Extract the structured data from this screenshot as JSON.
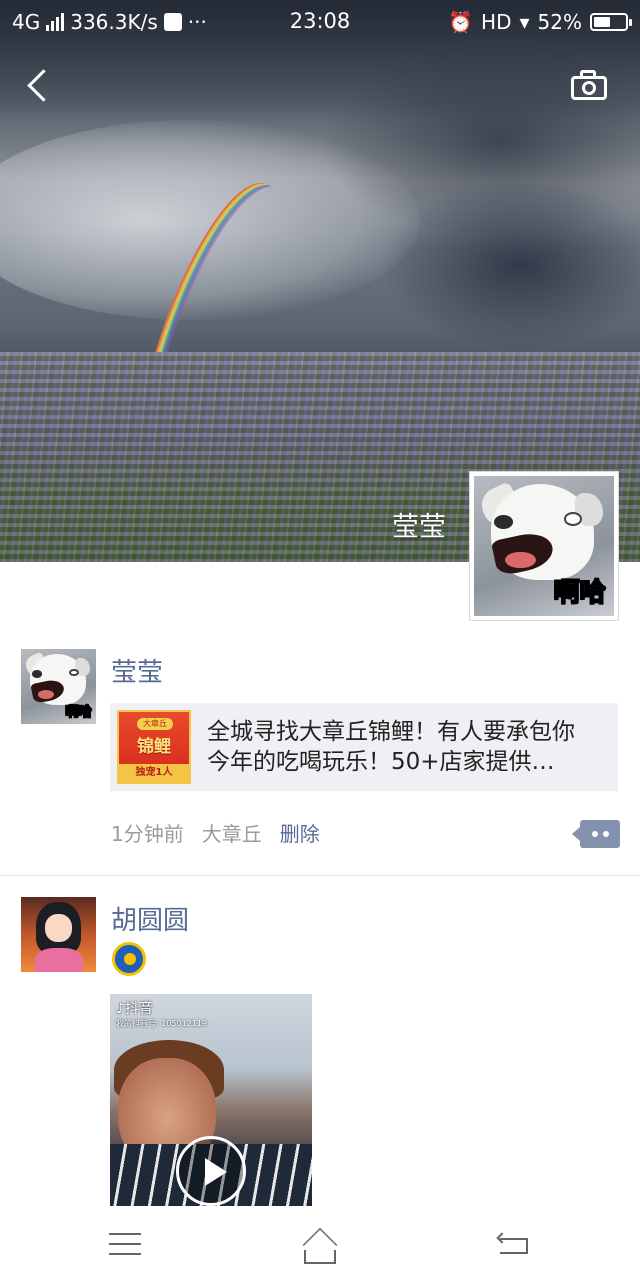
{
  "status_bar": {
    "network": "4G",
    "speed": "336.3K/s",
    "more": "···",
    "time": "23:08",
    "hd": "HD",
    "battery": "52%",
    "battery_level": 0.52
  },
  "header": {
    "back_icon": "back-chevron-icon",
    "camera_icon": "camera-icon"
  },
  "profile": {
    "name": "莹莹",
    "avatar_caption": "啊哈"
  },
  "posts": [
    {
      "username": "莹莹",
      "avatar_caption": "啊哈",
      "link": {
        "thumb_badge": "大章丘",
        "thumb_title": "锦鲤",
        "thumb_footer": "独宠1人",
        "text": "全城寻找大章丘锦鲤！有人要承包你今年的吃喝玩乐！50+店家提供…"
      },
      "time": "1分钟前",
      "location": "大章丘",
      "delete_label": "删除"
    },
    {
      "username": "胡圆圆",
      "emoji_icon": "moon-emoji-icon",
      "video": {
        "logo": "♪抖音",
        "account": "我的抖音号: 105012119"
      }
    }
  ],
  "nav": {
    "menu_icon": "menu-icon",
    "home_icon": "home-icon",
    "back_icon": "return-icon"
  }
}
